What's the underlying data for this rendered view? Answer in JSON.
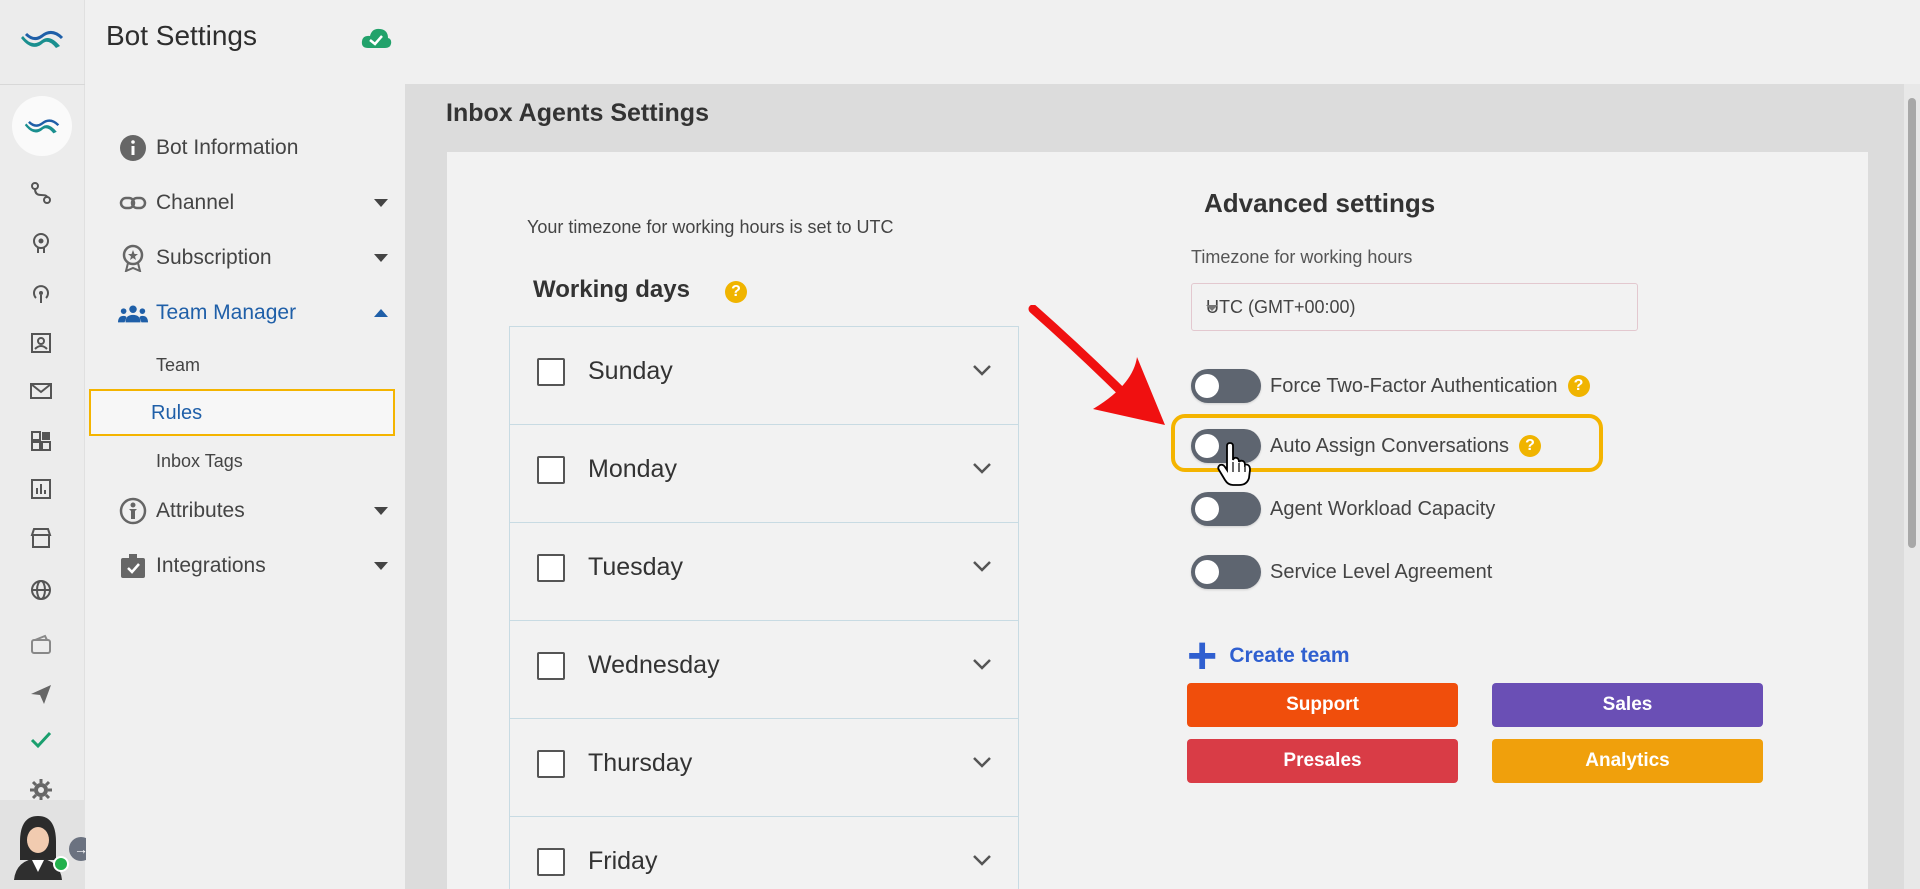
{
  "header": {
    "title": "Bot Settings"
  },
  "rail": {
    "icons": [
      "logo-icon",
      "bot-avatar-icon",
      "flow-icon",
      "brain-icon",
      "broadcast-icon",
      "contacts-icon",
      "mail-icon",
      "widgets-icon",
      "analytics-icon",
      "store-icon",
      "globe-icon",
      "wallet-icon",
      "send-icon",
      "check-icon",
      "gear-icon"
    ]
  },
  "nav": {
    "items": [
      {
        "label": "Bot Information",
        "icon": "info-icon"
      },
      {
        "label": "Channel",
        "icon": "link-icon"
      },
      {
        "label": "Subscription",
        "icon": "badge-icon"
      },
      {
        "label": "Team Manager",
        "icon": "team-icon"
      },
      {
        "label": "Attributes",
        "icon": "person-info-icon"
      },
      {
        "label": "Integrations",
        "icon": "integrations-icon"
      }
    ],
    "sub_items": [
      "Team",
      "Rules",
      "Inbox Tags"
    ]
  },
  "main": {
    "page_title": "Inbox Agents Settings",
    "timezone_note": "Your timezone for working hours is set to UTC",
    "working_days_title": "Working days",
    "days": [
      "Sunday",
      "Monday",
      "Tuesday",
      "Wednesday",
      "Thursday",
      "Friday"
    ]
  },
  "advanced": {
    "title": "Advanced settings",
    "timezone_label": "Timezone for working hours",
    "timezone_value": "UTC (GMT+00:00)",
    "toggles": [
      {
        "label": "Force Two-Factor Authentication",
        "on": false
      },
      {
        "label": "Auto Assign Conversations",
        "on": false
      },
      {
        "label": "Agent Workload Capacity",
        "on": false
      },
      {
        "label": "Service Level Agreement",
        "on": false
      }
    ],
    "create_team_label": "Create team",
    "teams": [
      {
        "label": "Support",
        "color": "#f04e0c"
      },
      {
        "label": "Sales",
        "color": "#6a4fb5"
      },
      {
        "label": "Presales",
        "color": "#d93c46"
      },
      {
        "label": "Analytics",
        "color": "#f0a00c"
      }
    ]
  },
  "colors": {
    "accent": "#1f5fa8",
    "highlight": "#f4b400",
    "toggle_off": "#5e6570",
    "link": "#2f5fd0"
  }
}
